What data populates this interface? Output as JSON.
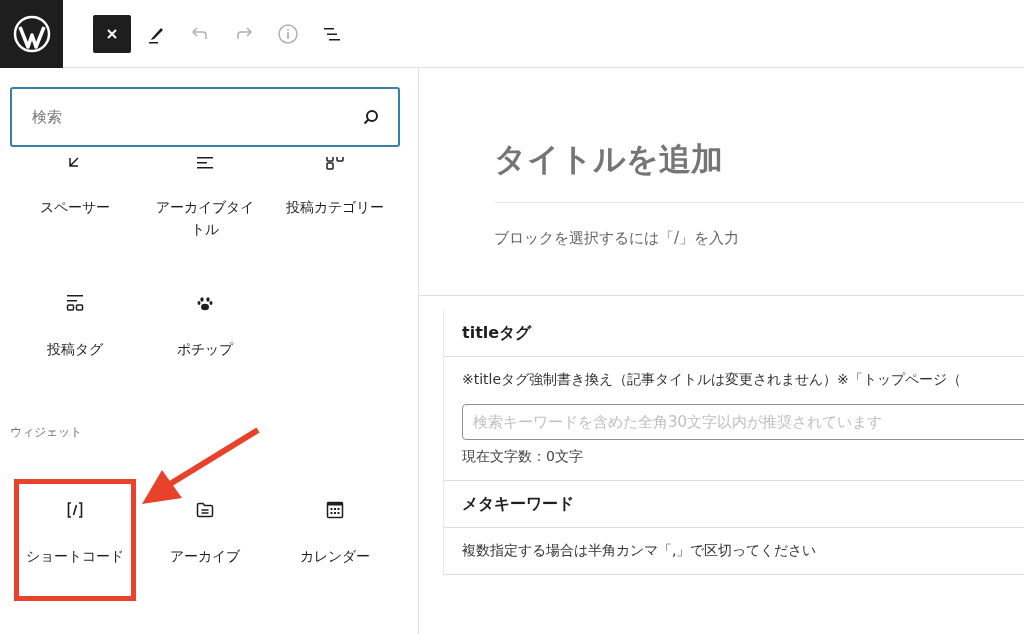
{
  "toolbar": [
    {
      "kind": "close",
      "disabled": false
    },
    {
      "kind": "pen",
      "disabled": false
    },
    {
      "kind": "undo",
      "disabled": true
    },
    {
      "kind": "redo",
      "disabled": true
    },
    {
      "kind": "info",
      "disabled": true
    },
    {
      "kind": "list-view",
      "disabled": false
    }
  ],
  "inserter": {
    "search": {
      "placeholder": "検索"
    },
    "sections": [
      {
        "items": [
          {
            "label": "スペーサー",
            "kind": "spacer",
            "highlighted": false
          },
          {
            "label": "アーカイブタイトル",
            "kind": "archive-title",
            "highlighted": false
          },
          {
            "label": "投稿カテゴリー",
            "kind": "categories",
            "highlighted": false
          },
          {
            "label": "投稿タグ",
            "kind": "tags",
            "highlighted": false
          },
          {
            "label": "ポチップ",
            "kind": "paw",
            "highlighted": false
          }
        ]
      },
      {
        "heading": "ウィジェット",
        "items": [
          {
            "label": "ショートコード",
            "kind": "shortcode",
            "highlighted": true
          },
          {
            "label": "アーカイブ",
            "kind": "archive",
            "highlighted": false
          },
          {
            "label": "カレンダー",
            "kind": "calendar",
            "highlighted": false
          }
        ]
      }
    ]
  },
  "editor": {
    "title_placeholder": "タイトルを追加",
    "block_hint": "ブロックを選択するには「/」を入力",
    "meta_boxes": [
      {
        "heading": "titleタグ",
        "description": "※titleタグ強制書き換え（記事タイトルは変更されません）※「トップページ（",
        "input_placeholder": "検索キーワードを含めた全角30文字以内が推奨されています",
        "counter": "現在文字数：0文字"
      },
      {
        "heading": "メタキーワード",
        "description": "複数指定する場合は半角カンマ「,」で区切ってください"
      }
    ]
  }
}
